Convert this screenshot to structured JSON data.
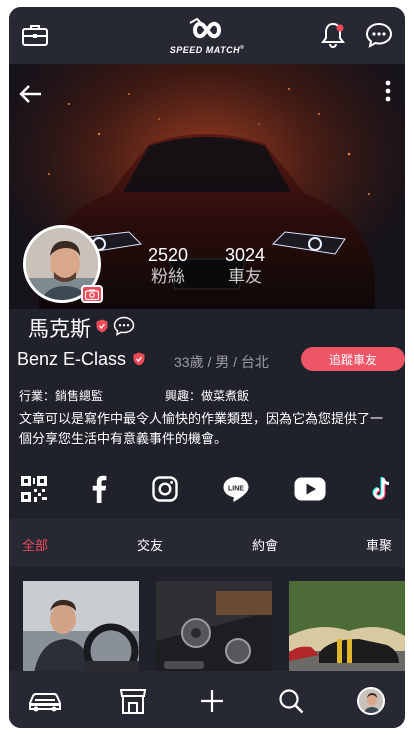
{
  "brand": {
    "wordmark": "SPEED MATCH",
    "reg_mark": "®"
  },
  "profile": {
    "name": "馬克斯",
    "followers_count": "2520",
    "followers_label": "粉絲",
    "carfriends_count": "3024",
    "carfriends_label": "車友",
    "car_model": "Benz E-Class",
    "demographics": "33歲 / 男 / 台北",
    "follow_button": "追蹤車友",
    "occupation": "行業：銷售總監",
    "interest": "興趣：做菜煮飯",
    "bio": "文章可以是寫作中最令人愉快的作業類型，因為它為您提供了一個分享您生活中有意義事件的機會。"
  },
  "social_icons": [
    "qrcode-icon",
    "facebook-icon",
    "instagram-icon",
    "line-icon",
    "youtube-icon",
    "tiktok-icon"
  ],
  "tabs": [
    {
      "label": "全部",
      "active": true
    },
    {
      "label": "交友",
      "active": false
    },
    {
      "label": "約會",
      "active": false
    },
    {
      "label": "車聚",
      "active": false
    }
  ],
  "bottom_nav": [
    "car-icon",
    "shop-icon",
    "plus-icon",
    "search-icon",
    "profile-avatar"
  ],
  "colors": {
    "accent": "#ee4a57",
    "background": "#20222b",
    "bar": "#262834"
  }
}
